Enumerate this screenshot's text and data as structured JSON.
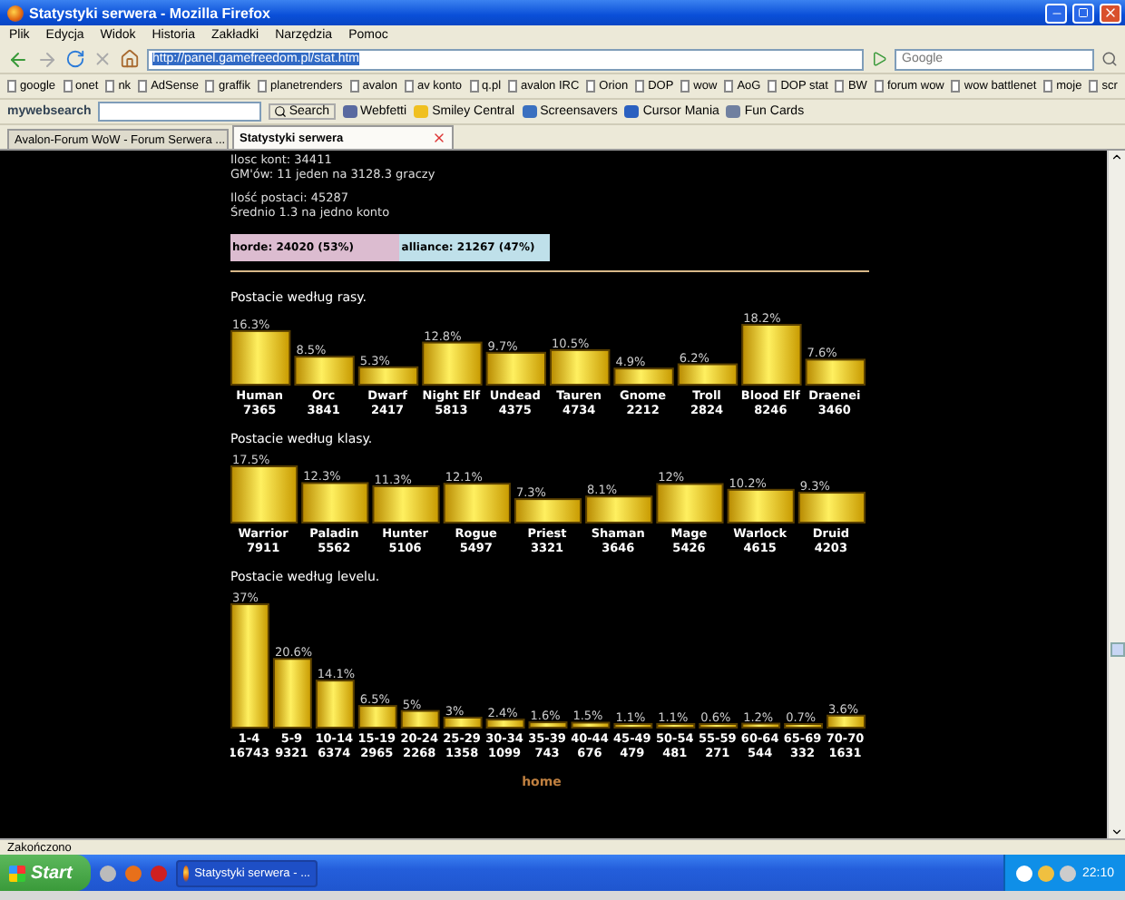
{
  "window": {
    "title": "Statystyki serwera - Mozilla Firefox"
  },
  "menu": [
    "Plik",
    "Edycja",
    "Widok",
    "Historia",
    "Zakładki",
    "Narzędzia",
    "Pomoc"
  ],
  "address_bar": {
    "url": "http://panel.gamefreedom.pl/stat.htm"
  },
  "search": {
    "placeholder": "Google"
  },
  "bookmarks": [
    "google",
    "onet",
    "nk",
    "AdSense",
    "graffik",
    "planetrenders",
    "avalon",
    "av konto",
    "q.pl",
    "avalon IRC",
    "Orion",
    "DOP",
    "wow",
    "AoG",
    "DOP stat",
    "BW",
    "forum wow",
    "wow battlenet",
    "moje",
    "scr"
  ],
  "toolbar": {
    "logo": "mywebsearch",
    "search_button": "Search",
    "links": [
      "Webfetti",
      "Smiley Central",
      "Screensavers",
      "Cursor Mania",
      "Fun Cards"
    ]
  },
  "tabs": [
    {
      "label": "Avalon-Forum WoW - Forum Serwera ...",
      "selected": false
    },
    {
      "label": "Statystyki serwera",
      "selected": true
    }
  ],
  "page": {
    "stats": [
      [
        "Ilosc kont: 34411",
        "GM'ów: 11 jeden na 3128.3 graczy"
      ],
      [
        "Ilość postaci: 45287",
        "Średnio 1.3 na jedno konto"
      ]
    ],
    "factions": [
      {
        "label": "horde: 24020 (53%)",
        "level": 0.53,
        "color": "#dcbcd0"
      },
      {
        "label": "alliance: 21267 (47%)",
        "level": 0.47,
        "color": "#bfe0ea"
      }
    ],
    "sections": [
      {
        "heading": "Postacie według rasy.",
        "counts": [
          "7365",
          "3841",
          "2417",
          "5813",
          "4375",
          "4734",
          "2212",
          "2824",
          "8246",
          "3460"
        ],
        "chart_data": {
          "type": "bar",
          "categories": [
            "Human",
            "Orc",
            "Dwarf",
            "Night Elf",
            "Undead",
            "Tauren",
            "Gnome",
            "Troll",
            "Blood Elf",
            "Draenei"
          ],
          "values": [
            16.3,
            8.5,
            5.3,
            12.8,
            9.7,
            10.5,
            4.9,
            6.2,
            18.2,
            7.6
          ],
          "value_labels": [
            "16.3%",
            "8.5%",
            "5.3%",
            "12.8%",
            "9.7%",
            "10.5%",
            "4.9%",
            "6.2%",
            "18.2%",
            "7.6%"
          ]
        }
      },
      {
        "heading": "Postacie według klasy.",
        "counts": [
          "7911",
          "5562",
          "5106",
          "5497",
          "3321",
          "3646",
          "5426",
          "4615",
          "4203"
        ],
        "chart_data": {
          "type": "bar",
          "categories": [
            "Warrior",
            "Paladin",
            "Hunter",
            "Rogue",
            "Priest",
            "Shaman",
            "Mage",
            "Warlock",
            "Druid"
          ],
          "values": [
            17.5,
            12.3,
            11.3,
            12.1,
            7.3,
            8.1,
            12,
            10.2,
            9.3
          ],
          "value_labels": [
            "17.5%",
            "12.3%",
            "11.3%",
            "12.1%",
            "7.3%",
            "8.1%",
            "12%",
            "10.2%",
            "9.3%"
          ]
        }
      },
      {
        "heading": "Postacie według levelu.",
        "counts": [
          "16743",
          "9321",
          "6374",
          "2965",
          "2268",
          "1358",
          "1099",
          "743",
          "676",
          "479",
          "481",
          "271",
          "544",
          "332",
          "1631"
        ],
        "chart_data": {
          "type": "bar",
          "categories": [
            "1-4",
            "5-9",
            "10-14",
            "15-19",
            "20-24",
            "25-29",
            "30-34",
            "35-39",
            "40-44",
            "45-49",
            "50-54",
            "55-59",
            "60-64",
            "65-69",
            "70-70"
          ],
          "values": [
            37,
            20.6,
            14.1,
            6.5,
            5,
            3,
            2.4,
            1.6,
            1.5,
            1.1,
            1.1,
            0.6,
            1.2,
            0.7,
            3.6
          ],
          "value_labels": [
            "37%",
            "20.6%",
            "14.1%",
            "6.5%",
            "5%",
            "3%",
            "2.4%",
            "1.6%",
            "1.5%",
            "1.1%",
            "1.1%",
            "0.6%",
            "1.2%",
            "0.7%",
            "3.6%"
          ]
        }
      }
    ],
    "home_link": "home"
  },
  "status_bar": "Zakończono",
  "taskbar": {
    "start": "Start",
    "tasks": [
      "Statystyki serwera - ..."
    ],
    "clock": "22:10"
  }
}
